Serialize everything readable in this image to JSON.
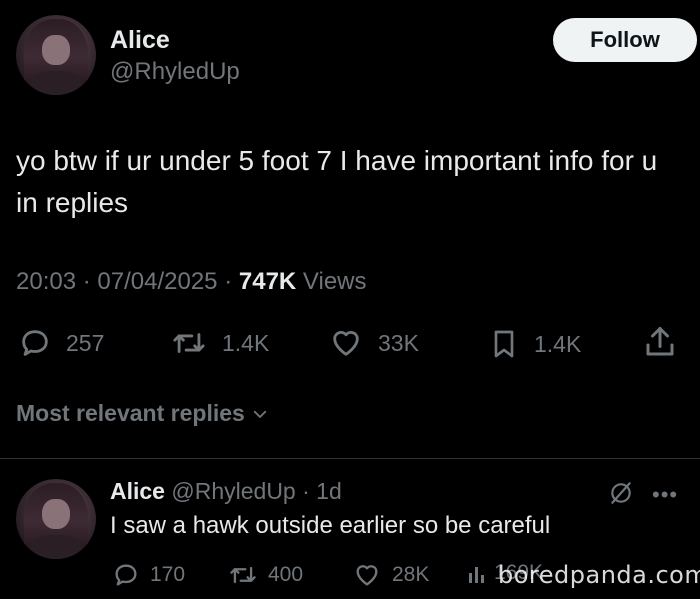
{
  "tweet": {
    "author_name": "Alice",
    "author_handle": "@RhyledUp",
    "follow_label": "Follow",
    "text": "yo btw if ur under 5 foot 7 I have important info for u in replies",
    "time": "20:03",
    "date": "07/04/2025",
    "views_count": "747K",
    "views_label": "Views",
    "stats": {
      "replies": "257",
      "reposts": "1.4K",
      "likes": "33K",
      "bookmarks": "1.4K"
    }
  },
  "replies_section": {
    "header": "Most relevant replies"
  },
  "reply": {
    "author_name": "Alice",
    "author_handle": "@RhyledUp",
    "age": "1d",
    "text": "I saw a hawk outside earlier so be careful",
    "stats": {
      "replies": "170",
      "reposts": "400",
      "likes": "28K",
      "views": "169K"
    }
  },
  "watermark": "boredpanda.com",
  "colors": {
    "background": "#000000",
    "text": "#e7e9ea",
    "secondary": "#71767b",
    "follow_bg": "#eff3f4"
  }
}
